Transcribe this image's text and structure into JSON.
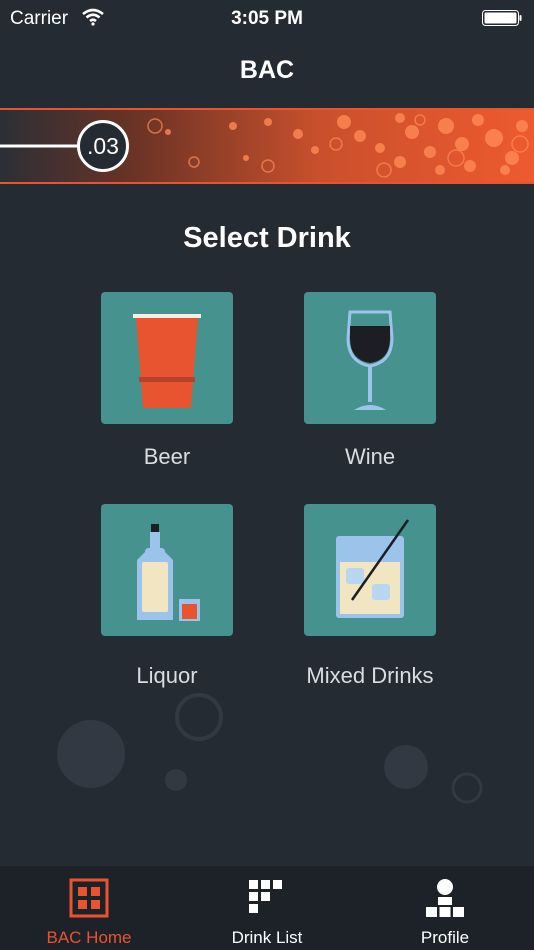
{
  "status_bar": {
    "carrier": "Carrier",
    "time": "3:05 PM"
  },
  "nav": {
    "title": "BAC"
  },
  "bac": {
    "value": ".03"
  },
  "main": {
    "title": "Select Drink",
    "drinks": [
      {
        "label": "Beer",
        "icon": "beer-cup-icon"
      },
      {
        "label": "Wine",
        "icon": "wine-glass-icon"
      },
      {
        "label": "Liquor",
        "icon": "liquor-bottle-icon"
      },
      {
        "label": "Mixed Drinks",
        "icon": "mixed-drink-icon"
      }
    ]
  },
  "tabs": [
    {
      "label": "BAC Home",
      "icon": "bac-home-icon",
      "selected": true
    },
    {
      "label": "Drink List",
      "icon": "drink-list-icon",
      "selected": false
    },
    {
      "label": "Profile",
      "icon": "profile-icon",
      "selected": false
    }
  ],
  "colors": {
    "background": "#252b33",
    "accent": "#e8542f",
    "tile": "#45928f",
    "tab_bar": "#1d2228"
  }
}
